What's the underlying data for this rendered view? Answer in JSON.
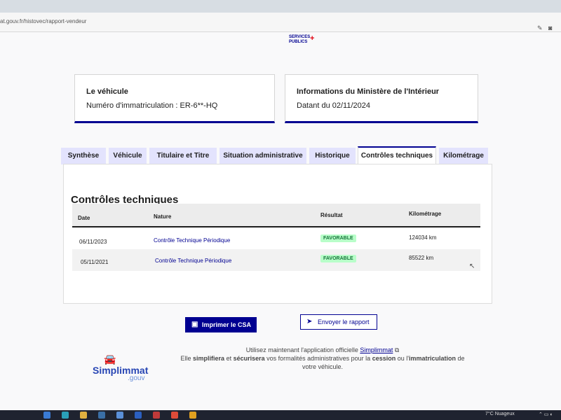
{
  "browser": {
    "url": "at.gouv.fr/histovec/rapport-vendeur"
  },
  "header": {
    "logo_line1": "SERVICES",
    "logo_line2": "PUBLICS",
    "logo_plus": "+"
  },
  "vehicle_card": {
    "title": "Le véhicule",
    "text": "Numéro d'immatriculation : ER-6**-HQ"
  },
  "ministry_card": {
    "title": "Informations du Ministère de l'Intérieur",
    "text": "Datant du 02/11/2024"
  },
  "tabs": [
    {
      "label": "Synthèse"
    },
    {
      "label": "Véhicule"
    },
    {
      "label": "Titulaire et Titre"
    },
    {
      "label": "Situation administrative"
    },
    {
      "label": "Historique"
    },
    {
      "label": "Contrôles techniques"
    },
    {
      "label": "Kilométrage"
    }
  ],
  "active_tab": "Contrôles techniques",
  "section": {
    "title": "Contrôles techniques",
    "columns": {
      "date": "Date",
      "nature": "Nature",
      "result": "Résultat",
      "km": "Kilométrage"
    },
    "rows": [
      {
        "date": "06/11/2023",
        "nature": "Contrôle Technique Périodique",
        "result": "FAVORABLE",
        "km": "124034 km"
      },
      {
        "date": "05/11/2021",
        "nature": "Contrôle Technique Périodique",
        "result": "FAVORABLE",
        "km": "85522 km"
      }
    ]
  },
  "actions": {
    "print_label": "Imprimer le CSA",
    "send_label": "Envoyer le rapport"
  },
  "simplimmat": {
    "name": "Simplimmat",
    "suffix": ".gouv"
  },
  "info": {
    "line1_pre": "Utilisez maintenant l'application officielle ",
    "line1_link": "Simplimmat",
    "line2_a": "Elle ",
    "line2_b": "simplifiera",
    "line2_c": " et ",
    "line2_d": "sécurisera",
    "line2_e": " vos formalités administratives pour la ",
    "line2_f": "cession",
    "line2_g": " ou l'",
    "line2_h": "immatriculation",
    "line2_i": " de",
    "line3": "votre véhicule."
  },
  "taskbar": {
    "weather": "7°C  Nuageux"
  },
  "colors": {
    "primary": "#000091",
    "badge_bg": "#b8fec9",
    "badge_text": "#18753c"
  }
}
